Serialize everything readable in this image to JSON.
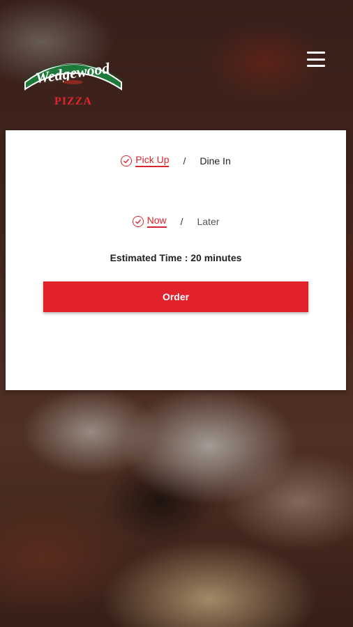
{
  "brand": {
    "name": "Wedgewood",
    "subtitle": "PIZZA",
    "primary_color": "#e3232b",
    "logo_green": "#1e7a3a"
  },
  "header": {
    "menu_icon": "hamburger-menu-icon"
  },
  "order_type": {
    "options": [
      "Pick Up",
      "Dine In"
    ],
    "selected": "Pick Up",
    "separator": "/"
  },
  "order_time": {
    "options": [
      "Now",
      "Later"
    ],
    "selected": "Now",
    "separator": "/"
  },
  "estimate_text": "Estimated Time : 20 minutes",
  "order_button_label": "Order"
}
